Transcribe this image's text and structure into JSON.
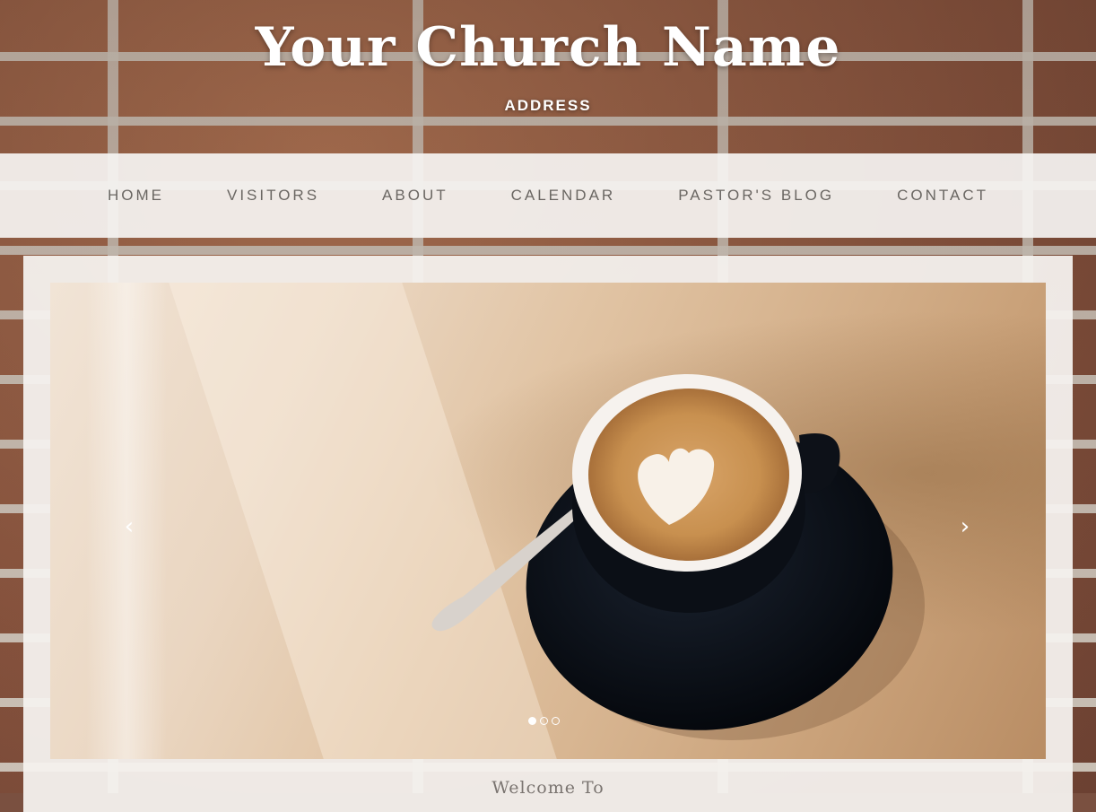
{
  "header": {
    "title": "Your Church Name",
    "address": "ADDRESS"
  },
  "nav": {
    "items": [
      {
        "label": "HOME"
      },
      {
        "label": "VISITORS"
      },
      {
        "label": "ABOUT"
      },
      {
        "label": "CALENDAR"
      },
      {
        "label": "PASTOR'S BLOG"
      },
      {
        "label": "CONTACT"
      }
    ]
  },
  "slider": {
    "image_subject": "coffee-latte-art",
    "prev_icon": "chevron-left-icon",
    "next_icon": "chevron-right-icon",
    "prev_glyph": "‹",
    "next_glyph": "›",
    "slide_count": 3,
    "active_slide": 1
  },
  "content": {
    "welcome_text": "Welcome To"
  },
  "colors": {
    "nav_background": "#f5f3f1",
    "nav_text": "#6a6662",
    "title_text": "#ffffff",
    "panel_background": "#f4f1ee"
  }
}
